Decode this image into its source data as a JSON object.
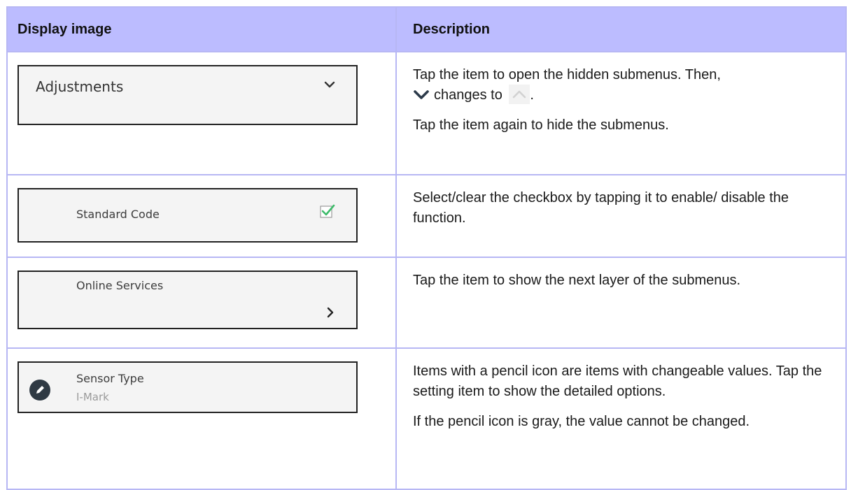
{
  "table": {
    "headers": {
      "display_image": "Display image",
      "description": "Description"
    },
    "rows": [
      {
        "item_label": "Adjustments",
        "text1_pre": "Tap the item to open the hidden submenus. Then,",
        "text1_mid": "changes to",
        "text1_post": ".",
        "text2": "Tap the item again to hide the submenus."
      },
      {
        "item_label": "Standard Code",
        "text1": "Select/clear the checkbox by tapping it to enable/ disable the function."
      },
      {
        "item_label": "Online Services",
        "text1": "Tap the item to show the next layer of the submenus."
      },
      {
        "item_label": "Sensor Type",
        "item_value": "I-Mark",
        "text1": "Items with a pencil icon are items with changeable values. Tap the setting item to show the detailed options.",
        "text2": "If the pencil icon is gray, the value cannot be changed."
      }
    ]
  },
  "icons": {
    "expand": "chevron-down-icon",
    "collapse": "chevron-up-icon",
    "checkbox": "checkbox-checked-icon",
    "next": "chevron-right-icon",
    "edit": "pencil-icon"
  },
  "colors": {
    "header_bg": "#bcbcff",
    "border": "#b7b7f4",
    "check": "#3dbb6a",
    "pencil_bg": "#2f3a44"
  }
}
